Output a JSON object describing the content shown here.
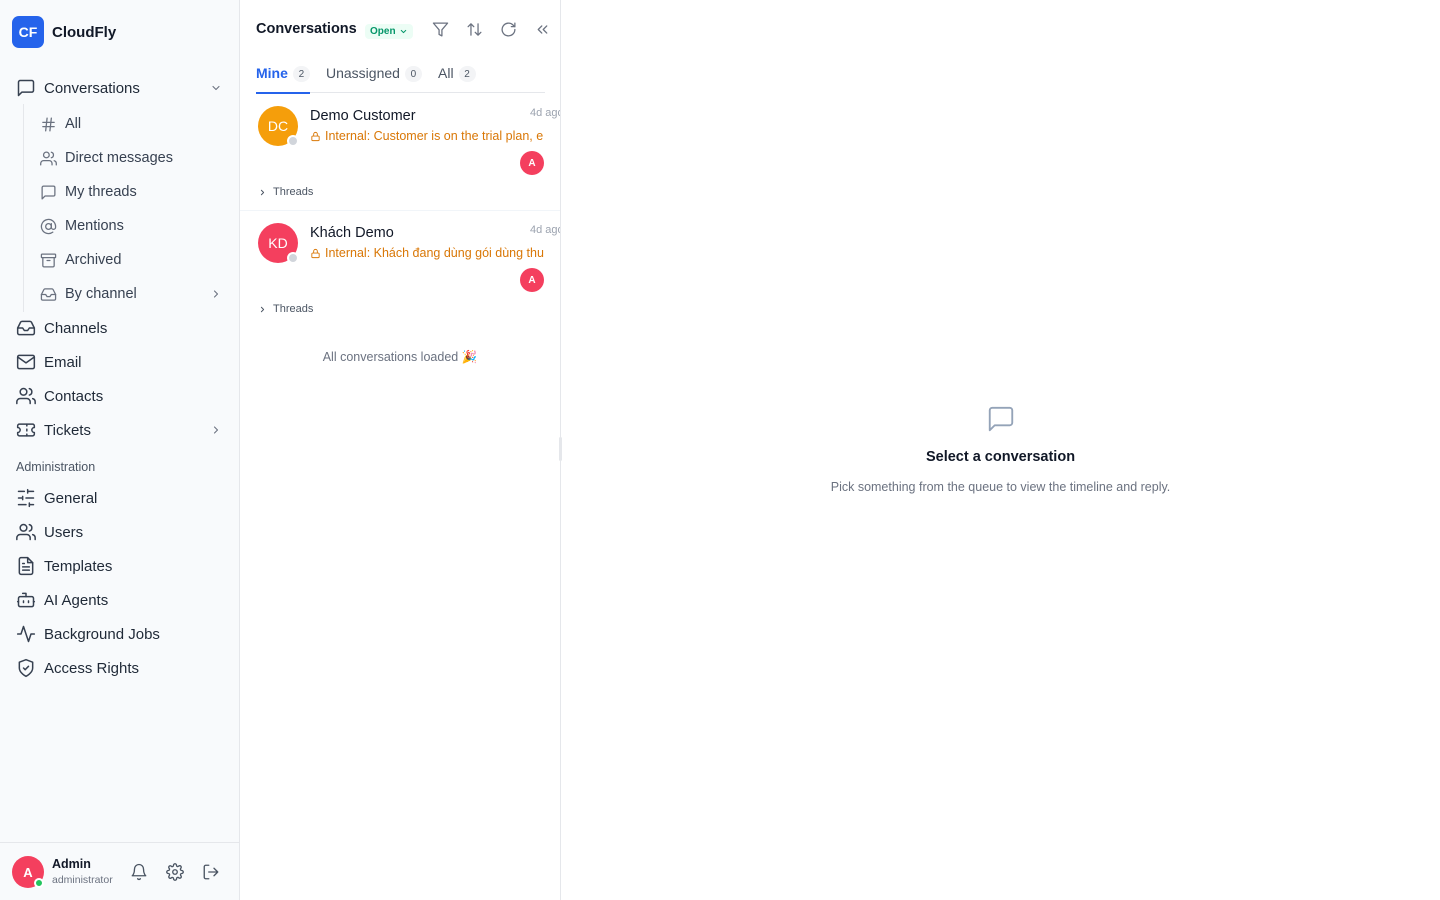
{
  "brand": {
    "logo_text": "CF",
    "name": "CloudFly",
    "accent_color": "#2563eb"
  },
  "sidebar": {
    "conversations": {
      "label": "Conversations",
      "icon": "message-square-icon"
    },
    "sub_items": [
      {
        "label": "All",
        "icon": "hash-icon"
      },
      {
        "label": "Direct messages",
        "icon": "users-icon"
      },
      {
        "label": "My threads",
        "icon": "message-square-icon"
      },
      {
        "label": "Mentions",
        "icon": "at-sign-icon"
      },
      {
        "label": "Archived",
        "icon": "archive-icon"
      },
      {
        "label": "By channel",
        "icon": "inbox-icon"
      }
    ],
    "items": [
      {
        "label": "Channels",
        "icon": "inbox-icon"
      },
      {
        "label": "Email",
        "icon": "mail-icon"
      },
      {
        "label": "Contacts",
        "icon": "users-icon"
      },
      {
        "label": "Tickets",
        "icon": "ticket-icon"
      }
    ],
    "admin_section_label": "Administration",
    "admin_items": [
      {
        "label": "General",
        "icon": "sliders-icon"
      },
      {
        "label": "Users",
        "icon": "users-icon"
      },
      {
        "label": "Templates",
        "icon": "file-text-icon"
      },
      {
        "label": "AI Agents",
        "icon": "bot-icon"
      },
      {
        "label": "Background Jobs",
        "icon": "activity-icon"
      },
      {
        "label": "Access Rights",
        "icon": "shield-icon"
      }
    ]
  },
  "user": {
    "initial": "A",
    "name": "Admin",
    "role": "administrator",
    "avatar_color": "#f43f5e",
    "status_color": "#22c55e"
  },
  "list_panel": {
    "title": "Conversations",
    "status_filter": "Open",
    "tabs": [
      {
        "label": "Mine",
        "count": "2",
        "active": true
      },
      {
        "label": "Unassigned",
        "count": "0",
        "active": false
      },
      {
        "label": "All",
        "count": "2",
        "active": false
      }
    ],
    "conversations": [
      {
        "initials": "DC",
        "avatar_color": "#f59e0b",
        "name": "Demo Customer",
        "time": "4d ago",
        "preview": "Internal: Customer is on the trial plan, e",
        "agent_initial": "A",
        "threads_label": "Threads"
      },
      {
        "initials": "KD",
        "avatar_color": "#f43f5e",
        "name": "Khách Demo",
        "time": "4d ago",
        "preview": "Internal: Khách đang dùng gói dùng thu",
        "agent_initial": "A",
        "threads_label": "Threads"
      }
    ],
    "footer_text": "All conversations loaded 🎉"
  },
  "empty_state": {
    "icon": "message-square-icon",
    "title": "Select a conversation",
    "subtitle": "Pick something from the queue to view the timeline and reply."
  }
}
